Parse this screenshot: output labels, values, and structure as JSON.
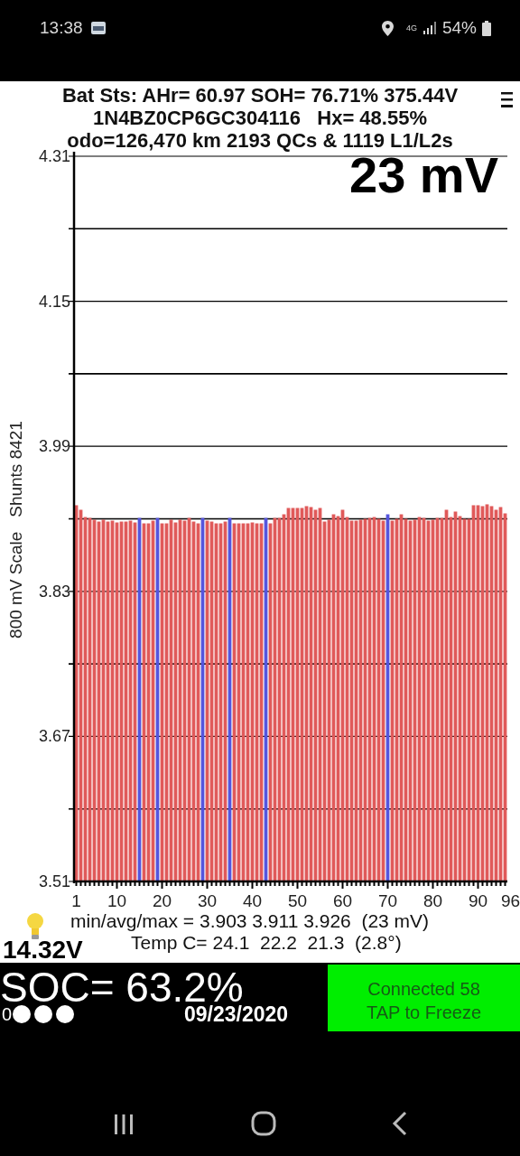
{
  "status_bar": {
    "time": "13:38",
    "network": "4G",
    "battery": "54%"
  },
  "header": {
    "lines": [
      "Bat Sts: AHr= 60.97 SOH= 76.71% 375.44V",
      "1N4BZ0CP6GC304116   Hx= 48.55%",
      "odo=126,470 km 2193 QCs & 1119 L1/L2s"
    ]
  },
  "chart": {
    "spread": "23 mV",
    "axis_label": "800 mV Scale   Shunts 8421",
    "chart_data": {
      "type": "bar",
      "x": [
        1,
        2,
        3,
        4,
        5,
        6,
        7,
        8,
        9,
        10,
        11,
        12,
        13,
        14,
        15,
        16,
        17,
        18,
        19,
        20,
        21,
        22,
        23,
        24,
        25,
        26,
        27,
        28,
        29,
        30,
        31,
        32,
        33,
        34,
        35,
        36,
        37,
        38,
        39,
        40,
        41,
        42,
        43,
        44,
        45,
        46,
        47,
        48,
        49,
        50,
        51,
        52,
        53,
        54,
        55,
        56,
        57,
        58,
        59,
        60,
        61,
        62,
        63,
        64,
        65,
        66,
        67,
        68,
        69,
        70,
        71,
        72,
        73,
        74,
        75,
        76,
        77,
        78,
        79,
        80,
        81,
        82,
        83,
        84,
        85,
        86,
        87,
        88,
        89,
        90,
        91,
        92,
        93,
        94,
        95,
        96
      ],
      "series": [
        {
          "color": "#e05a5a",
          "values": [
            3.925,
            3.92,
            3.912,
            3.911,
            3.909,
            3.907,
            3.909,
            3.907,
            3.908,
            3.906,
            3.907,
            3.907,
            3.908,
            3.906,
            null,
            3.905,
            3.905,
            3.908,
            null,
            3.905,
            3.905,
            3.909,
            3.906,
            3.909,
            3.908,
            3.911,
            3.907,
            3.905,
            null,
            3.908,
            3.907,
            3.905,
            3.905,
            3.907,
            null,
            3.905,
            3.905,
            3.905,
            3.905,
            3.906,
            3.905,
            3.905,
            null,
            3.905,
            3.911,
            3.911,
            3.915,
            3.922,
            3.922,
            3.922,
            3.922,
            3.924,
            3.923,
            3.92,
            3.922,
            3.907,
            3.909,
            3.915,
            3.913,
            3.92,
            3.912,
            3.908,
            3.908,
            3.909,
            3.91,
            3.911,
            3.912,
            3.91,
            3.908,
            null,
            3.908,
            3.91,
            3.915,
            3.91,
            3.908,
            3.909,
            3.912,
            3.911,
            3.908,
            3.909,
            3.911,
            3.911,
            3.92,
            3.912,
            3.918,
            3.913,
            3.91,
            3.91,
            3.925,
            3.925,
            3.924,
            3.926,
            3.924,
            3.92,
            3.923,
            3.916
          ]
        },
        {
          "color": "#5555dd",
          "values": [
            null,
            null,
            null,
            null,
            null,
            null,
            null,
            null,
            null,
            null,
            null,
            null,
            null,
            null,
            3.911,
            null,
            null,
            null,
            3.911,
            null,
            null,
            null,
            null,
            null,
            null,
            null,
            null,
            null,
            3.911,
            null,
            null,
            null,
            null,
            null,
            3.911,
            null,
            null,
            null,
            null,
            null,
            null,
            null,
            3.911,
            null,
            null,
            null,
            null,
            null,
            null,
            null,
            null,
            null,
            null,
            null,
            null,
            null,
            null,
            null,
            null,
            null,
            null,
            null,
            null,
            null,
            null,
            null,
            null,
            null,
            null,
            3.915,
            null,
            null,
            null,
            null,
            null,
            null,
            null,
            null,
            null,
            null,
            null,
            null,
            null,
            null,
            null,
            null,
            null,
            null,
            null,
            null,
            null,
            null,
            null,
            null,
            null,
            null
          ]
        }
      ],
      "xlim": [
        0.5,
        96.5
      ],
      "ylim": [
        3.51,
        4.31
      ],
      "grid": true,
      "yticks": [
        3.51,
        3.67,
        3.83,
        3.99,
        4.15,
        4.31
      ],
      "xticks": [
        1,
        10,
        20,
        30,
        40,
        50,
        60,
        70,
        80,
        90,
        96
      ]
    }
  },
  "stats": {
    "minmax": "min/avg/max = 3.903 3.911 3.926  (23 mV)",
    "temps": "Temp C= 24.1  22.2  21.3  (2.8°)",
    "aux_voltage": "14.32V"
  },
  "soc": {
    "value": "SOC= 63.2%",
    "date": "09/23/2020",
    "indicator": "0"
  },
  "connection_button": {
    "lines": [
      "Connected 58",
      "TAP to Freeze"
    ]
  }
}
